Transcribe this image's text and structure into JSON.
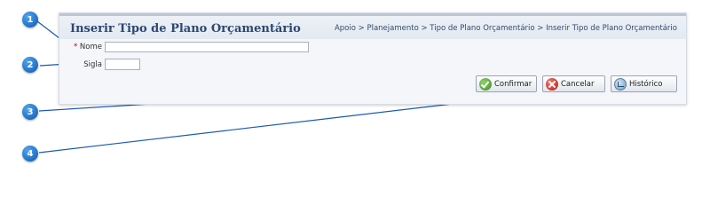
{
  "header": {
    "title": "Inserir Tipo de Plano Orçamentário",
    "breadcrumb": "Apoio > Planejamento > Tipo de Plano Orçamentário > Inserir Tipo de Plano Orçamentário"
  },
  "form": {
    "nome": {
      "required_marker": "*",
      "label": "Nome",
      "value": ""
    },
    "sigla": {
      "label": "Sigla",
      "value": ""
    }
  },
  "buttons": {
    "confirmar": {
      "label": "Confirmar",
      "icon": "check-icon"
    },
    "cancelar": {
      "label": "Cancelar",
      "icon": "cancel-icon"
    },
    "historico": {
      "label": "Histórico",
      "icon": "history-icon"
    }
  },
  "callouts": [
    "1",
    "2",
    "3",
    "4"
  ],
  "colors": {
    "title": "#2c4872",
    "callout": "#1b73d6",
    "panel_background": "#f4f6f9",
    "leader_line": "#1a57b5"
  }
}
